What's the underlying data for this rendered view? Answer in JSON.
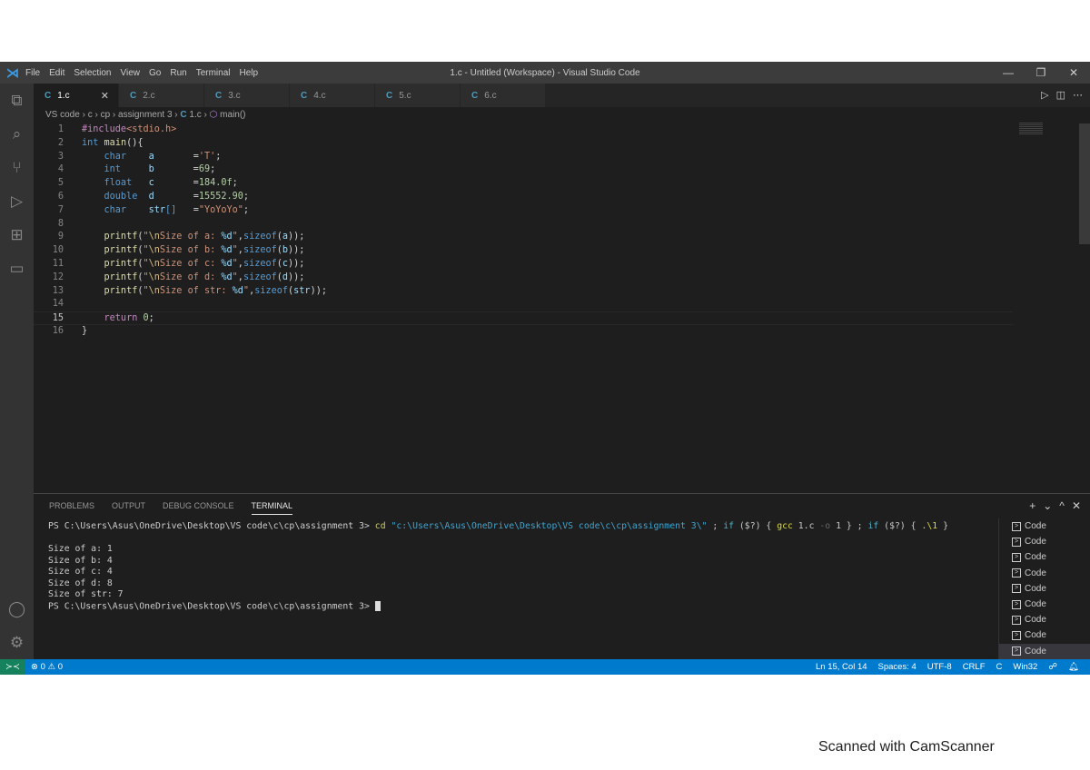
{
  "window": {
    "title": "1.c - Untitled (Workspace) - Visual Studio Code",
    "controls": [
      "—",
      "❐",
      "✕"
    ]
  },
  "menu": [
    "File",
    "Edit",
    "Selection",
    "View",
    "Go",
    "Run",
    "Terminal",
    "Help"
  ],
  "activity": [
    "files-icon",
    "search-icon",
    "source-control-icon",
    "run-debug-icon",
    "extensions-icon",
    "remote-explorer-icon"
  ],
  "activity_bottom": [
    "account-icon",
    "settings-gear-icon"
  ],
  "tabs": [
    {
      "label": "1.c",
      "active": true
    },
    {
      "label": "2.c"
    },
    {
      "label": "3.c"
    },
    {
      "label": "4.c"
    },
    {
      "label": "5.c"
    },
    {
      "label": "6.c"
    }
  ],
  "breadcrumb": [
    "VS code",
    "c",
    "cp",
    "assignment 3",
    "1.c",
    "main()"
  ],
  "editor": {
    "current_line": 15,
    "lines": [
      [
        [
          "#include",
          "pp"
        ],
        [
          "<stdio.h>",
          "st"
        ]
      ],
      [
        [
          "int",
          "kw"
        ],
        [
          " ",
          "tx"
        ],
        [
          "main",
          "fn"
        ],
        [
          "(){",
          "tx"
        ]
      ],
      [
        [
          "    char",
          "kw"
        ],
        [
          "    a       ",
          "vr"
        ],
        [
          "=",
          "tx"
        ],
        [
          "'T'",
          "st"
        ],
        [
          ";",
          "tx"
        ]
      ],
      [
        [
          "    int",
          "kw"
        ],
        [
          "     b       ",
          "vr"
        ],
        [
          "=",
          "tx"
        ],
        [
          "69",
          "nm"
        ],
        [
          ";",
          "tx"
        ]
      ],
      [
        [
          "    float",
          "kw"
        ],
        [
          "   c       ",
          "vr"
        ],
        [
          "=",
          "tx"
        ],
        [
          "184.0f",
          "nm"
        ],
        [
          ";",
          "tx"
        ]
      ],
      [
        [
          "    double",
          "kw"
        ],
        [
          "  d       ",
          "vr"
        ],
        [
          "=",
          "tx"
        ],
        [
          "15552.90",
          "nm"
        ],
        [
          ";",
          "tx"
        ]
      ],
      [
        [
          "    char",
          "kw"
        ],
        [
          "    str",
          "vr"
        ],
        [
          "[]",
          "kw"
        ],
        [
          "   =",
          "tx"
        ],
        [
          "\"YoYoYo\"",
          "st"
        ],
        [
          ";",
          "tx"
        ]
      ],
      [],
      [
        [
          "    printf",
          "fn"
        ],
        [
          "(",
          "tx"
        ],
        [
          "\"",
          "st"
        ],
        [
          "\\n",
          "es"
        ],
        [
          "Size of a: ",
          "st"
        ],
        [
          "%d",
          "fm"
        ],
        [
          "\"",
          "st"
        ],
        [
          ",",
          "tx"
        ],
        [
          "sizeof",
          "kw"
        ],
        [
          "(",
          "tx"
        ],
        [
          "a",
          "vr"
        ],
        [
          "));",
          "tx"
        ]
      ],
      [
        [
          "    printf",
          "fn"
        ],
        [
          "(",
          "tx"
        ],
        [
          "\"",
          "st"
        ],
        [
          "\\n",
          "es"
        ],
        [
          "Size of b: ",
          "st"
        ],
        [
          "%d",
          "fm"
        ],
        [
          "\"",
          "st"
        ],
        [
          ",",
          "tx"
        ],
        [
          "sizeof",
          "kw"
        ],
        [
          "(",
          "tx"
        ],
        [
          "b",
          "vr"
        ],
        [
          "));",
          "tx"
        ]
      ],
      [
        [
          "    printf",
          "fn"
        ],
        [
          "(",
          "tx"
        ],
        [
          "\"",
          "st"
        ],
        [
          "\\n",
          "es"
        ],
        [
          "Size of c: ",
          "st"
        ],
        [
          "%d",
          "fm"
        ],
        [
          "\"",
          "st"
        ],
        [
          ",",
          "tx"
        ],
        [
          "sizeof",
          "kw"
        ],
        [
          "(",
          "tx"
        ],
        [
          "c",
          "vr"
        ],
        [
          "));",
          "tx"
        ]
      ],
      [
        [
          "    printf",
          "fn"
        ],
        [
          "(",
          "tx"
        ],
        [
          "\"",
          "st"
        ],
        [
          "\\n",
          "es"
        ],
        [
          "Size of d: ",
          "st"
        ],
        [
          "%d",
          "fm"
        ],
        [
          "\"",
          "st"
        ],
        [
          ",",
          "tx"
        ],
        [
          "sizeof",
          "kw"
        ],
        [
          "(",
          "tx"
        ],
        [
          "d",
          "vr"
        ],
        [
          "));",
          "tx"
        ]
      ],
      [
        [
          "    printf",
          "fn"
        ],
        [
          "(",
          "tx"
        ],
        [
          "\"",
          "st"
        ],
        [
          "\\n",
          "es"
        ],
        [
          "Size of str: ",
          "st"
        ],
        [
          "%d",
          "fm"
        ],
        [
          "\"",
          "st"
        ],
        [
          ",",
          "tx"
        ],
        [
          "sizeof",
          "kw"
        ],
        [
          "(",
          "tx"
        ],
        [
          "str",
          "vr"
        ],
        [
          "));",
          "tx"
        ]
      ],
      [],
      [
        [
          "    return",
          "pp"
        ],
        [
          " ",
          "tx"
        ],
        [
          "0",
          "nm"
        ],
        [
          ";",
          "tx"
        ]
      ],
      [
        [
          "}",
          "tx"
        ]
      ]
    ]
  },
  "panel": {
    "tabs": [
      "PROBLEMS",
      "OUTPUT",
      "DEBUG CONSOLE",
      "TERMINAL"
    ],
    "active_tab": "TERMINAL",
    "actions": [
      "+",
      "⌄",
      "^",
      "✕"
    ]
  },
  "terminal": {
    "lines": [
      [
        [
          "PS C:\\Users\\Asus\\OneDrive\\Desktop\\VS code\\c\\cp\\assignment 3> ",
          ""
        ],
        [
          "cd",
          "tc"
        ],
        [
          " \"c:\\Users\\Asus\\OneDrive\\Desktop\\VS code\\c\\cp\\assignment 3\\\"",
          "tq"
        ],
        [
          " ; ",
          ""
        ],
        [
          "if",
          "tk"
        ],
        [
          " ($?) { ",
          ""
        ],
        [
          "gcc",
          "tg"
        ],
        [
          " 1.c ",
          ""
        ],
        [
          "-o",
          "to"
        ],
        [
          " 1 } ; ",
          ""
        ],
        [
          "if",
          "tk"
        ],
        [
          " ($?) { ",
          ""
        ],
        [
          ".\\1",
          "tg"
        ],
        [
          " }",
          ""
        ]
      ],
      [],
      [
        [
          "Size of a: 1",
          ""
        ]
      ],
      [
        [
          "Size of b: 4",
          ""
        ]
      ],
      [
        [
          "Size of c: 4",
          ""
        ]
      ],
      [
        [
          "Size of d: 8",
          ""
        ]
      ],
      [
        [
          "Size of str: 7",
          ""
        ]
      ],
      [
        [
          "PS C:\\Users\\Asus\\OneDrive\\Desktop\\VS code\\c\\cp\\assignment 3> ",
          ""
        ]
      ]
    ],
    "instances": [
      "Code",
      "Code",
      "Code",
      "Code",
      "Code",
      "Code",
      "Code",
      "Code",
      "Code"
    ]
  },
  "status": {
    "errors": "0",
    "warnings": "0",
    "right": [
      "Ln 15, Col 14",
      "Spaces: 4",
      "UTF-8",
      "CRLF",
      "C",
      "Win32"
    ]
  },
  "footer": "Scanned with CamScanner",
  "colors": {
    "accent": "#007acc",
    "remote": "#16825d",
    "titlebar": "#3c3c3c",
    "editor_bg": "#1e1e1e"
  }
}
